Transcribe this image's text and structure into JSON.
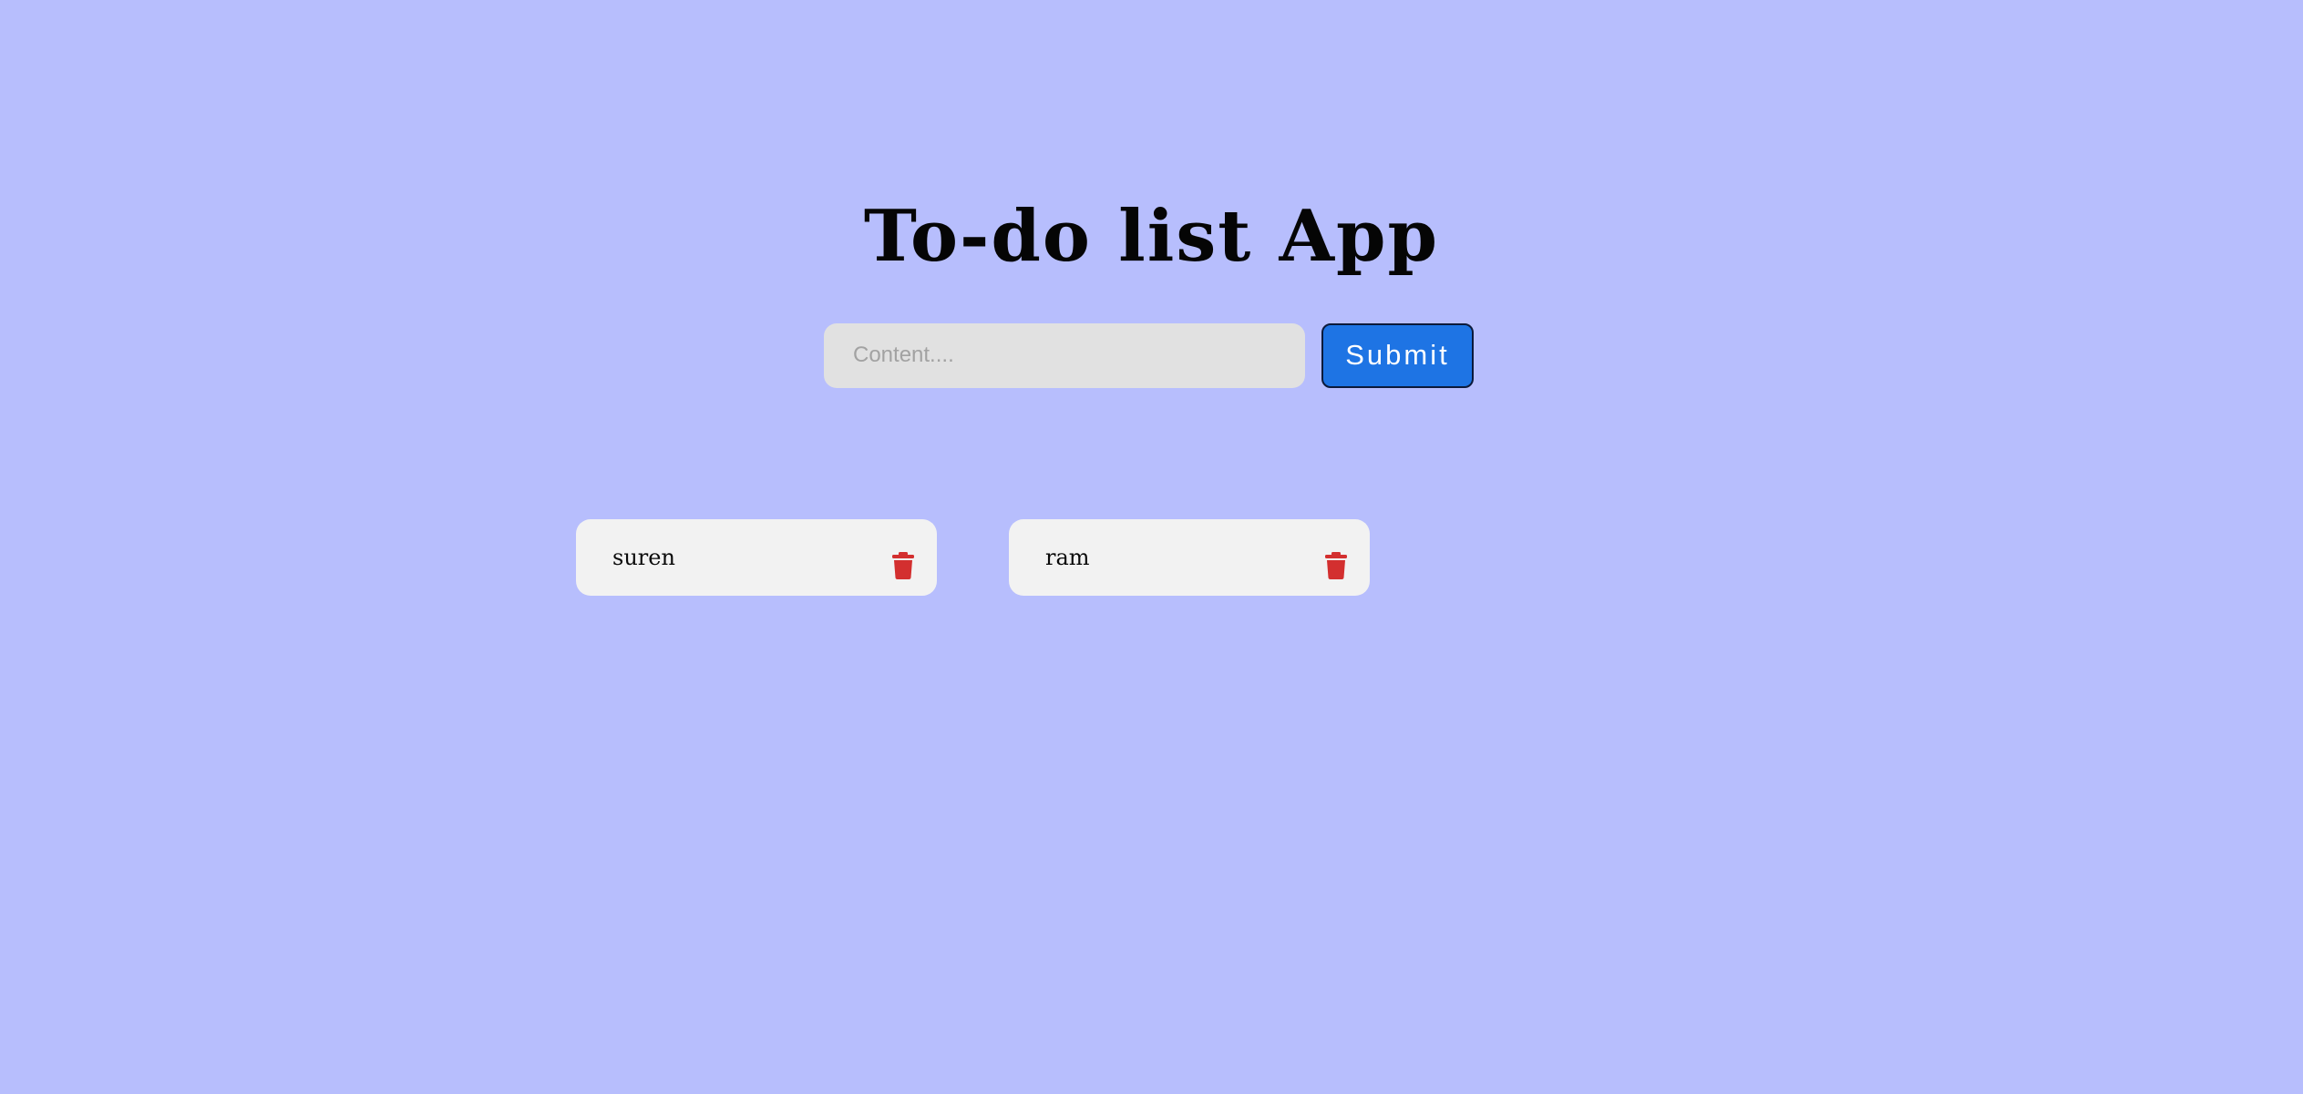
{
  "app": {
    "title": "To-do list App"
  },
  "form": {
    "input_value": "",
    "input_placeholder": "Content....",
    "submit_label": "Submit"
  },
  "todos": [
    {
      "text": "suren",
      "delete_icon": "trash-icon"
    },
    {
      "text": "ram",
      "delete_icon": "trash-icon"
    }
  ],
  "colors": {
    "background": "#b7befd",
    "input_bg": "#e1e1e1",
    "submit_bg": "#1e74e4",
    "card_bg": "#f2f2f2",
    "delete_icon": "#d32f2f"
  }
}
